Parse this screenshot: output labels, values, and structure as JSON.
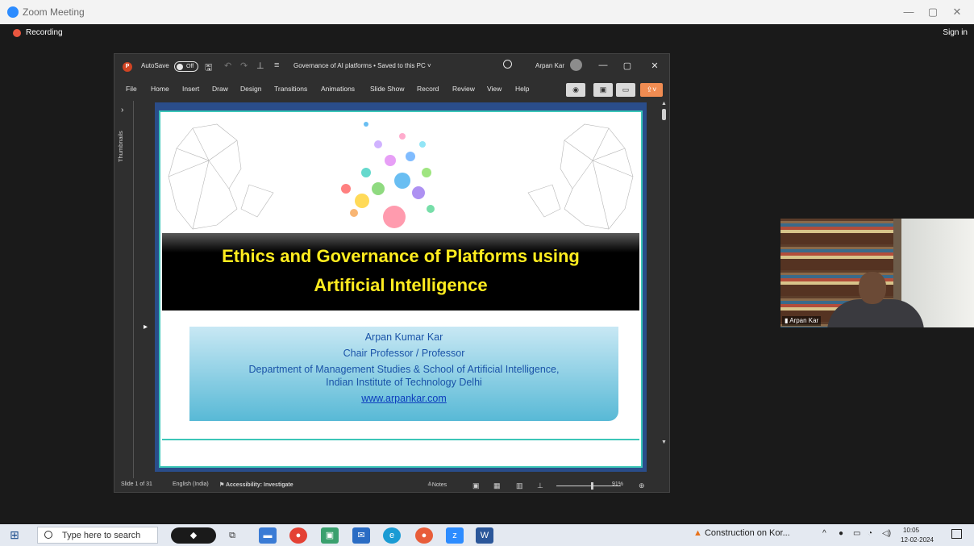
{
  "zoom": {
    "window_title": "Zoom Meeting",
    "recording_label": "Recording",
    "sign_in_label": "Sign in",
    "window_controls": [
      "—",
      "▢",
      "✕"
    ]
  },
  "ppt": {
    "autosave_label": "AutoSave",
    "autosave_state": "Off",
    "doc_title": "Governance of AI platforms • Saved to this PC ˅",
    "user_name": "Arpan Kar",
    "ribbon_tabs": [
      "File",
      "Home",
      "Insert",
      "Draw",
      "Design",
      "Transitions",
      "Animations",
      "Slide Show",
      "Record",
      "Review",
      "View",
      "Help"
    ],
    "thumbnails_label": "Thumbnails",
    "status": {
      "slide_of": "Slide 1 of 31",
      "language": "English (India)",
      "accessibility": "Accessibility: Investigate",
      "notes": "Notes",
      "zoom_level": "91%"
    }
  },
  "slide": {
    "title_line1": "Ethics and Governance of Platforms using",
    "title_line2": "Artificial Intelligence",
    "author_name": "Arpan Kumar Kar",
    "author_role": "Chair Professor / Professor",
    "author_dept": "Department of Management Studies & School of Artificial Intelligence,",
    "author_institute": "Indian Institute of Technology Delhi",
    "author_website": "www.arpankar.com"
  },
  "video": {
    "participant_name": "Arpan Kar"
  },
  "taskbar": {
    "search_placeholder": "Type here to search",
    "notification_text": "Construction on Kor...",
    "time": "10:05",
    "date": "12-02-2024"
  },
  "colors": {
    "slide_title": "#ffec1f",
    "slide_border": "#3cc6b8",
    "author_text": "#1a53a8"
  }
}
